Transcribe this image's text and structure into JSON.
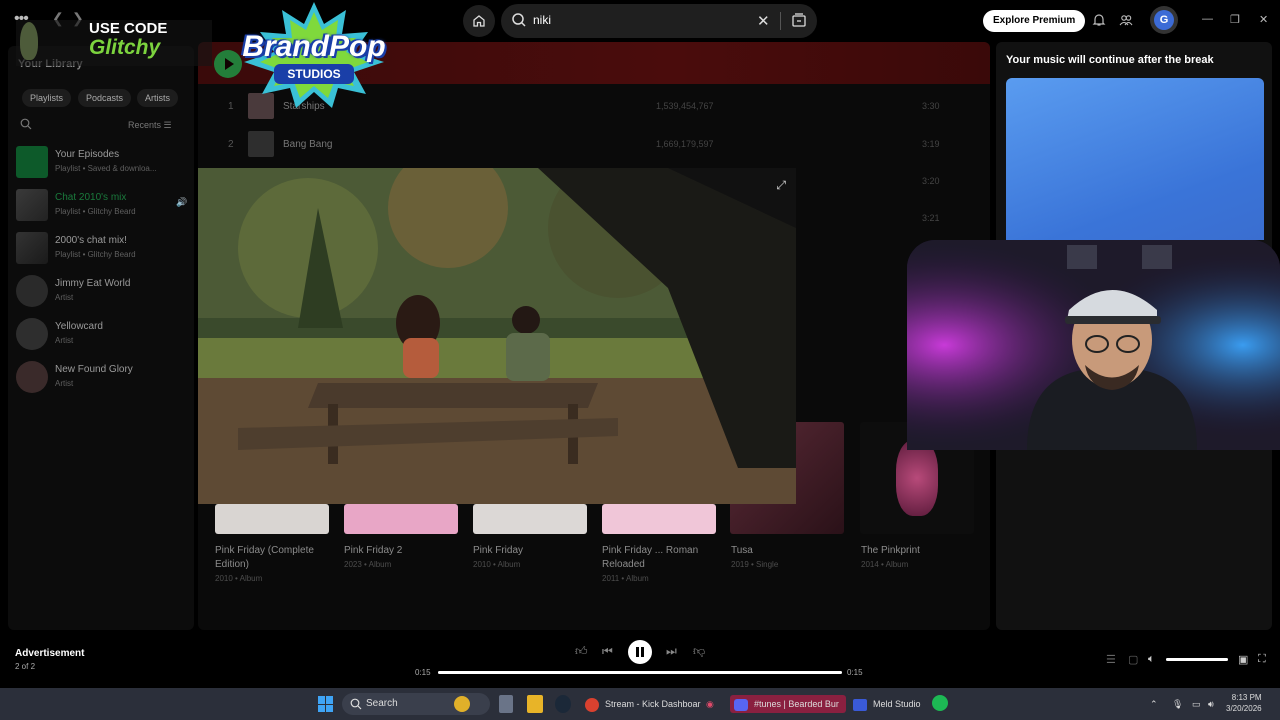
{
  "overlay": {
    "promo_line1": "USE CODE",
    "promo_line2": "Glitchy",
    "logo_line1": "BrandPop",
    "logo_line2": "STUDIOS"
  },
  "topbar": {
    "search_value": "niki",
    "premium_label": "Explore Premium",
    "avatar_letter": "G"
  },
  "sidebar": {
    "title": "Your Library",
    "chips": [
      "Playlists",
      "Podcasts",
      "Artists"
    ],
    "recents_label": "Recents",
    "items": [
      {
        "name": "Your Episodes",
        "sub": "Playlist • Saved & downloa..."
      },
      {
        "name": "Chat 2010's mix",
        "sub": "Playlist • Glitchy Beard"
      },
      {
        "name": "2000's chat mix!",
        "sub": "Playlist • Glitchy Beard"
      },
      {
        "name": "Jimmy Eat World",
        "sub": "Artist"
      },
      {
        "name": "Yellowcard",
        "sub": "Artist"
      },
      {
        "name": "New Found Glory",
        "sub": "Artist"
      }
    ]
  },
  "tracks": [
    {
      "num": "1",
      "title": "Starships",
      "plays": "1,539,454,767",
      "duration": "3:30"
    },
    {
      "num": "2",
      "title": "Bang Bang",
      "plays": "1,669,179,597",
      "duration": "3:19"
    },
    {
      "num": "",
      "title": "",
      "plays": "",
      "duration": "3:20"
    },
    {
      "num": "",
      "title": "",
      "plays": "",
      "duration": "3:21"
    }
  ],
  "albums": [
    {
      "title": "Pink Friday (Complete Edition)",
      "sub": "2010 • Album"
    },
    {
      "title": "Pink Friday 2",
      "sub": "2023 • Album"
    },
    {
      "title": "Pink Friday",
      "sub": "2010 • Album"
    },
    {
      "title": "Pink Friday ... Roman Reloaded",
      "sub": "2011 • Album"
    },
    {
      "title": "Tusa",
      "sub": "2019 • Single"
    },
    {
      "title": "The Pinkprint",
      "sub": "2014 • Album"
    }
  ],
  "ad_panel": {
    "title": "Your music will continue after the break"
  },
  "player": {
    "ad_label": "Advertisement",
    "ad_count": "2 of 2",
    "time_elapsed": "0:15",
    "time_total": "0:15",
    "progress_fraction": 1.0,
    "volume_fraction": 1.0
  },
  "taskbar": {
    "search_label": "Search",
    "items": [
      "Stream - Kick Dashboar",
      "#tunes",
      "| Bearded Bur",
      "Meld Studio"
    ],
    "time": "8:13 PM",
    "date": "3/20/2026"
  },
  "colors": {
    "accent_green": "#1db954",
    "banner_red": "#4a0c0c",
    "ad_blue": "#4a88e6"
  }
}
